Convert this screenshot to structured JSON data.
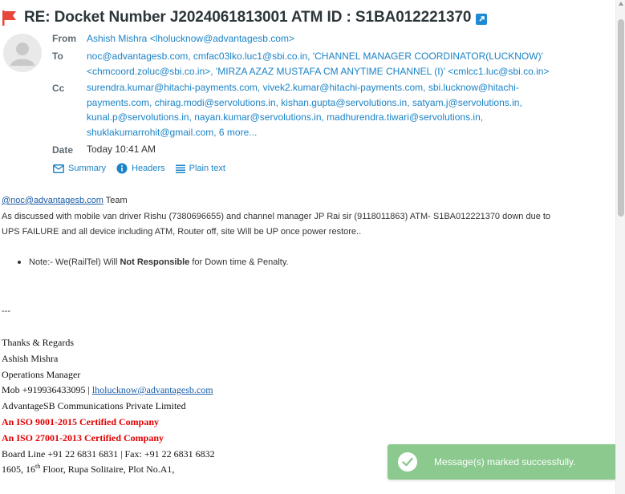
{
  "subject": "RE: Docket Number J2024061813001 ATM ID : S1BA012221370",
  "header": {
    "from_label": "From",
    "from_value": "Ashish Mishra <lholucknow@advantagesb.com>",
    "to_label": "To",
    "to_line1": "noc@advantagesb.com, cmfac03lko.luc1@sbi.co.in, 'CHANNEL MANAGER COORDINATOR(LUCKNOW)'",
    "to_line2": "<chmcoord.zoluc@sbi.co.in>, 'MIRZA AZAZ MUSTAFA CM ANYTIME CHANNEL (I)' <cmlcc1.luc@sbi.co.in>",
    "cc_label": "Cc",
    "cc_line1": "surendra.kumar@hitachi-payments.com, vivek2.kumar@hitachi-payments.com, sbi.lucknow@hitachi-",
    "cc_line2": "payments.com, chirag.modi@servolutions.in, kishan.gupta@servolutions.in, satyam.j@servolutions.in,",
    "cc_line3": "kunal.p@servolutions.in, nayan.kumar@servolutions.in, madhurendra.tiwari@servolutions.in,",
    "cc_line4": "shuklakumarrohit@gmail.com,",
    "cc_more": "6 more...",
    "date_label": "Date",
    "date_value": "Today 10:41 AM"
  },
  "actions": {
    "summary": "Summary",
    "headers": "Headers",
    "plain_text": "Plain text"
  },
  "body": {
    "mention": "@noc@advantagesb.com",
    "mention_suffix": " Team",
    "para1_line1": "As discussed with mobile van driver Rishu (7380696655) and channel manager JP Rai sir (9118011863) ATM- S1BA012221370 down due to",
    "para1_line2": "UPS FAILURE and all device including ATM, Router off, site Will be UP once power restore..",
    "note_prefix": "Note:- We(RailTel) Will ",
    "note_bold": "Not Responsible",
    "note_suffix": " for Down time & Penalty.",
    "separator": "---"
  },
  "signature": {
    "regards": "Thanks & Regards",
    "name": "Ashish Mishra",
    "title": "Operations Manager",
    "mob_prefix": "Mob +919936433095 | ",
    "email": "lholucknow@advantagesb.com",
    "company": "AdvantageSB Communications Private Limited",
    "iso1": "An ISO 9001-2015 Certified Company",
    "iso2": "An ISO 27001-2013 Certified Company",
    "board": "Board Line +91 22 6831 6831 | Fax: +91 22 6831 6832",
    "addr_num": "1605, 16",
    "addr_sup": "th",
    "addr_rest": " Floor, Rupa Solitaire, Plot No.A1,"
  },
  "toast": {
    "message": "Message(s) marked successfully."
  },
  "colors": {
    "link": "#1c83c6",
    "flag": "#e8453c",
    "toast_bg": "#8bc98f",
    "iso_red": "#e00000"
  },
  "icons": [
    "flag-icon",
    "external-link-icon",
    "avatar-placeholder-icon",
    "envelope-icon",
    "info-icon",
    "lines-icon",
    "check-circle-icon"
  ]
}
